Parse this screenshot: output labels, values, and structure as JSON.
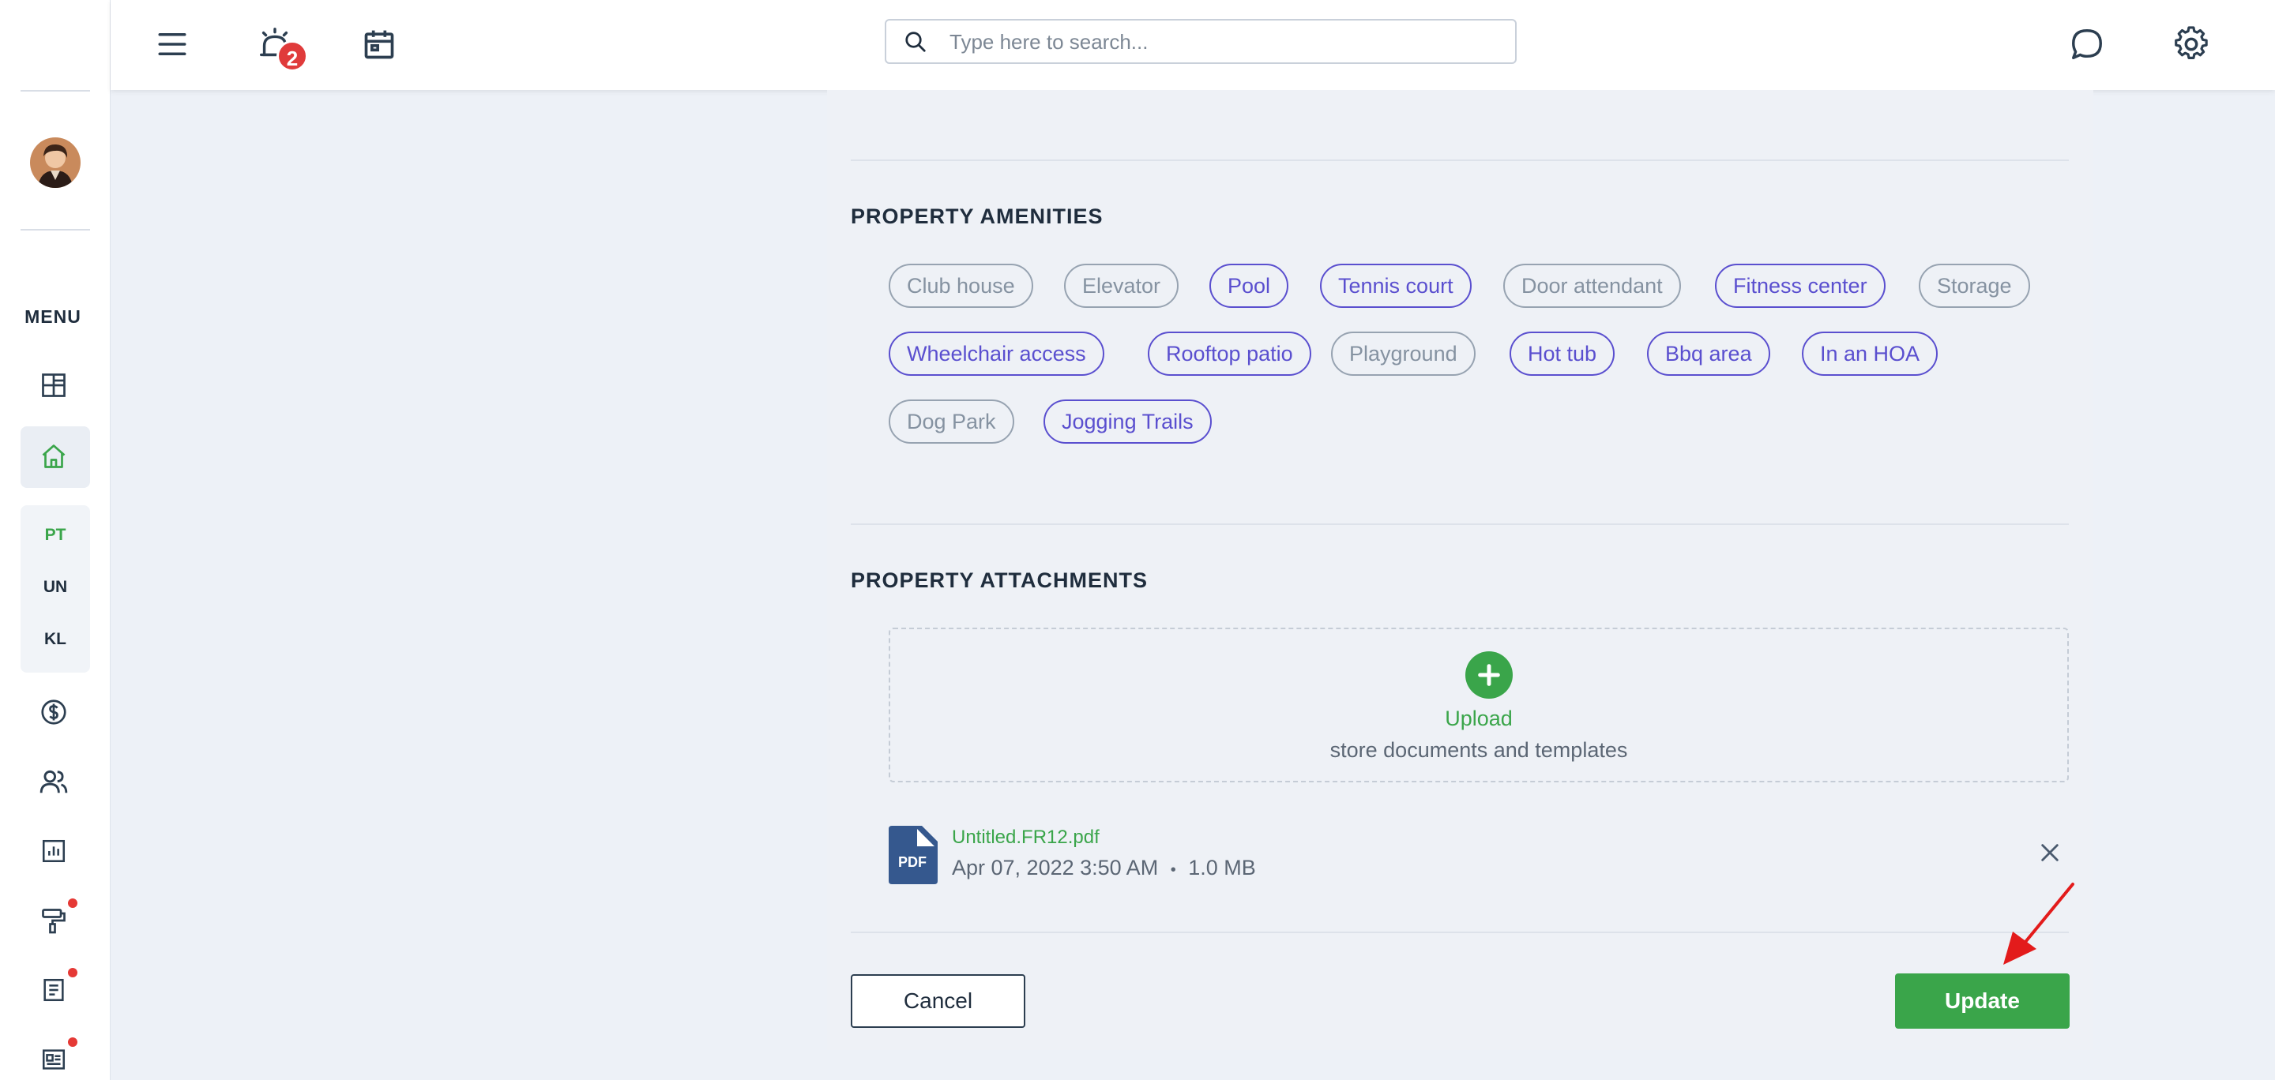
{
  "sidebar": {
    "menu_label": "MENU",
    "sub_items": [
      {
        "label": "PT",
        "color": "#3aa54a"
      },
      {
        "label": "UN",
        "color": "#1f2d3d"
      },
      {
        "label": "KL",
        "color": "#1f2d3d"
      }
    ],
    "icons": [
      "dashboard-icon",
      "home-icon",
      "dollar-icon",
      "users-icon",
      "reports-icon",
      "maintenance-icon",
      "documents-icon",
      "news-icon"
    ]
  },
  "topbar": {
    "notification_count": "2",
    "search_placeholder": "Type here to search..."
  },
  "amenities": {
    "title": "PROPERTY AMENITIES",
    "items": [
      {
        "label": "Club house",
        "selected": false
      },
      {
        "label": "Elevator",
        "selected": false
      },
      {
        "label": "Pool",
        "selected": true
      },
      {
        "label": "Tennis court",
        "selected": true
      },
      {
        "label": "Door attendant",
        "selected": false
      },
      {
        "label": "Fitness center",
        "selected": true
      },
      {
        "label": "Storage",
        "selected": false
      },
      {
        "label": "Wheelchair access",
        "selected": true
      },
      {
        "label": "Rooftop patio",
        "selected": true
      },
      {
        "label": "Playground",
        "selected": false
      },
      {
        "label": "Hot tub",
        "selected": true
      },
      {
        "label": "Bbq area",
        "selected": true
      },
      {
        "label": "In an HOA",
        "selected": true
      },
      {
        "label": "Dog Park",
        "selected": false
      },
      {
        "label": "Jogging Trails",
        "selected": true
      }
    ]
  },
  "attachments": {
    "title": "PROPERTY ATTACHMENTS",
    "upload_label": "Upload",
    "upload_sub": "store documents and templates",
    "file": {
      "type": "PDF",
      "name": "Untitled.FR12.pdf",
      "date": "Apr 07, 2022 3:50 AM",
      "separator": "•",
      "size": "1.0 MB"
    }
  },
  "actions": {
    "cancel_label": "Cancel",
    "update_label": "Update"
  },
  "colors": {
    "accent_green": "#3aa54a",
    "chip_selected": "#5a4fcf",
    "chip_unselected": "#8592a1",
    "badge_red": "#e03b3b"
  }
}
